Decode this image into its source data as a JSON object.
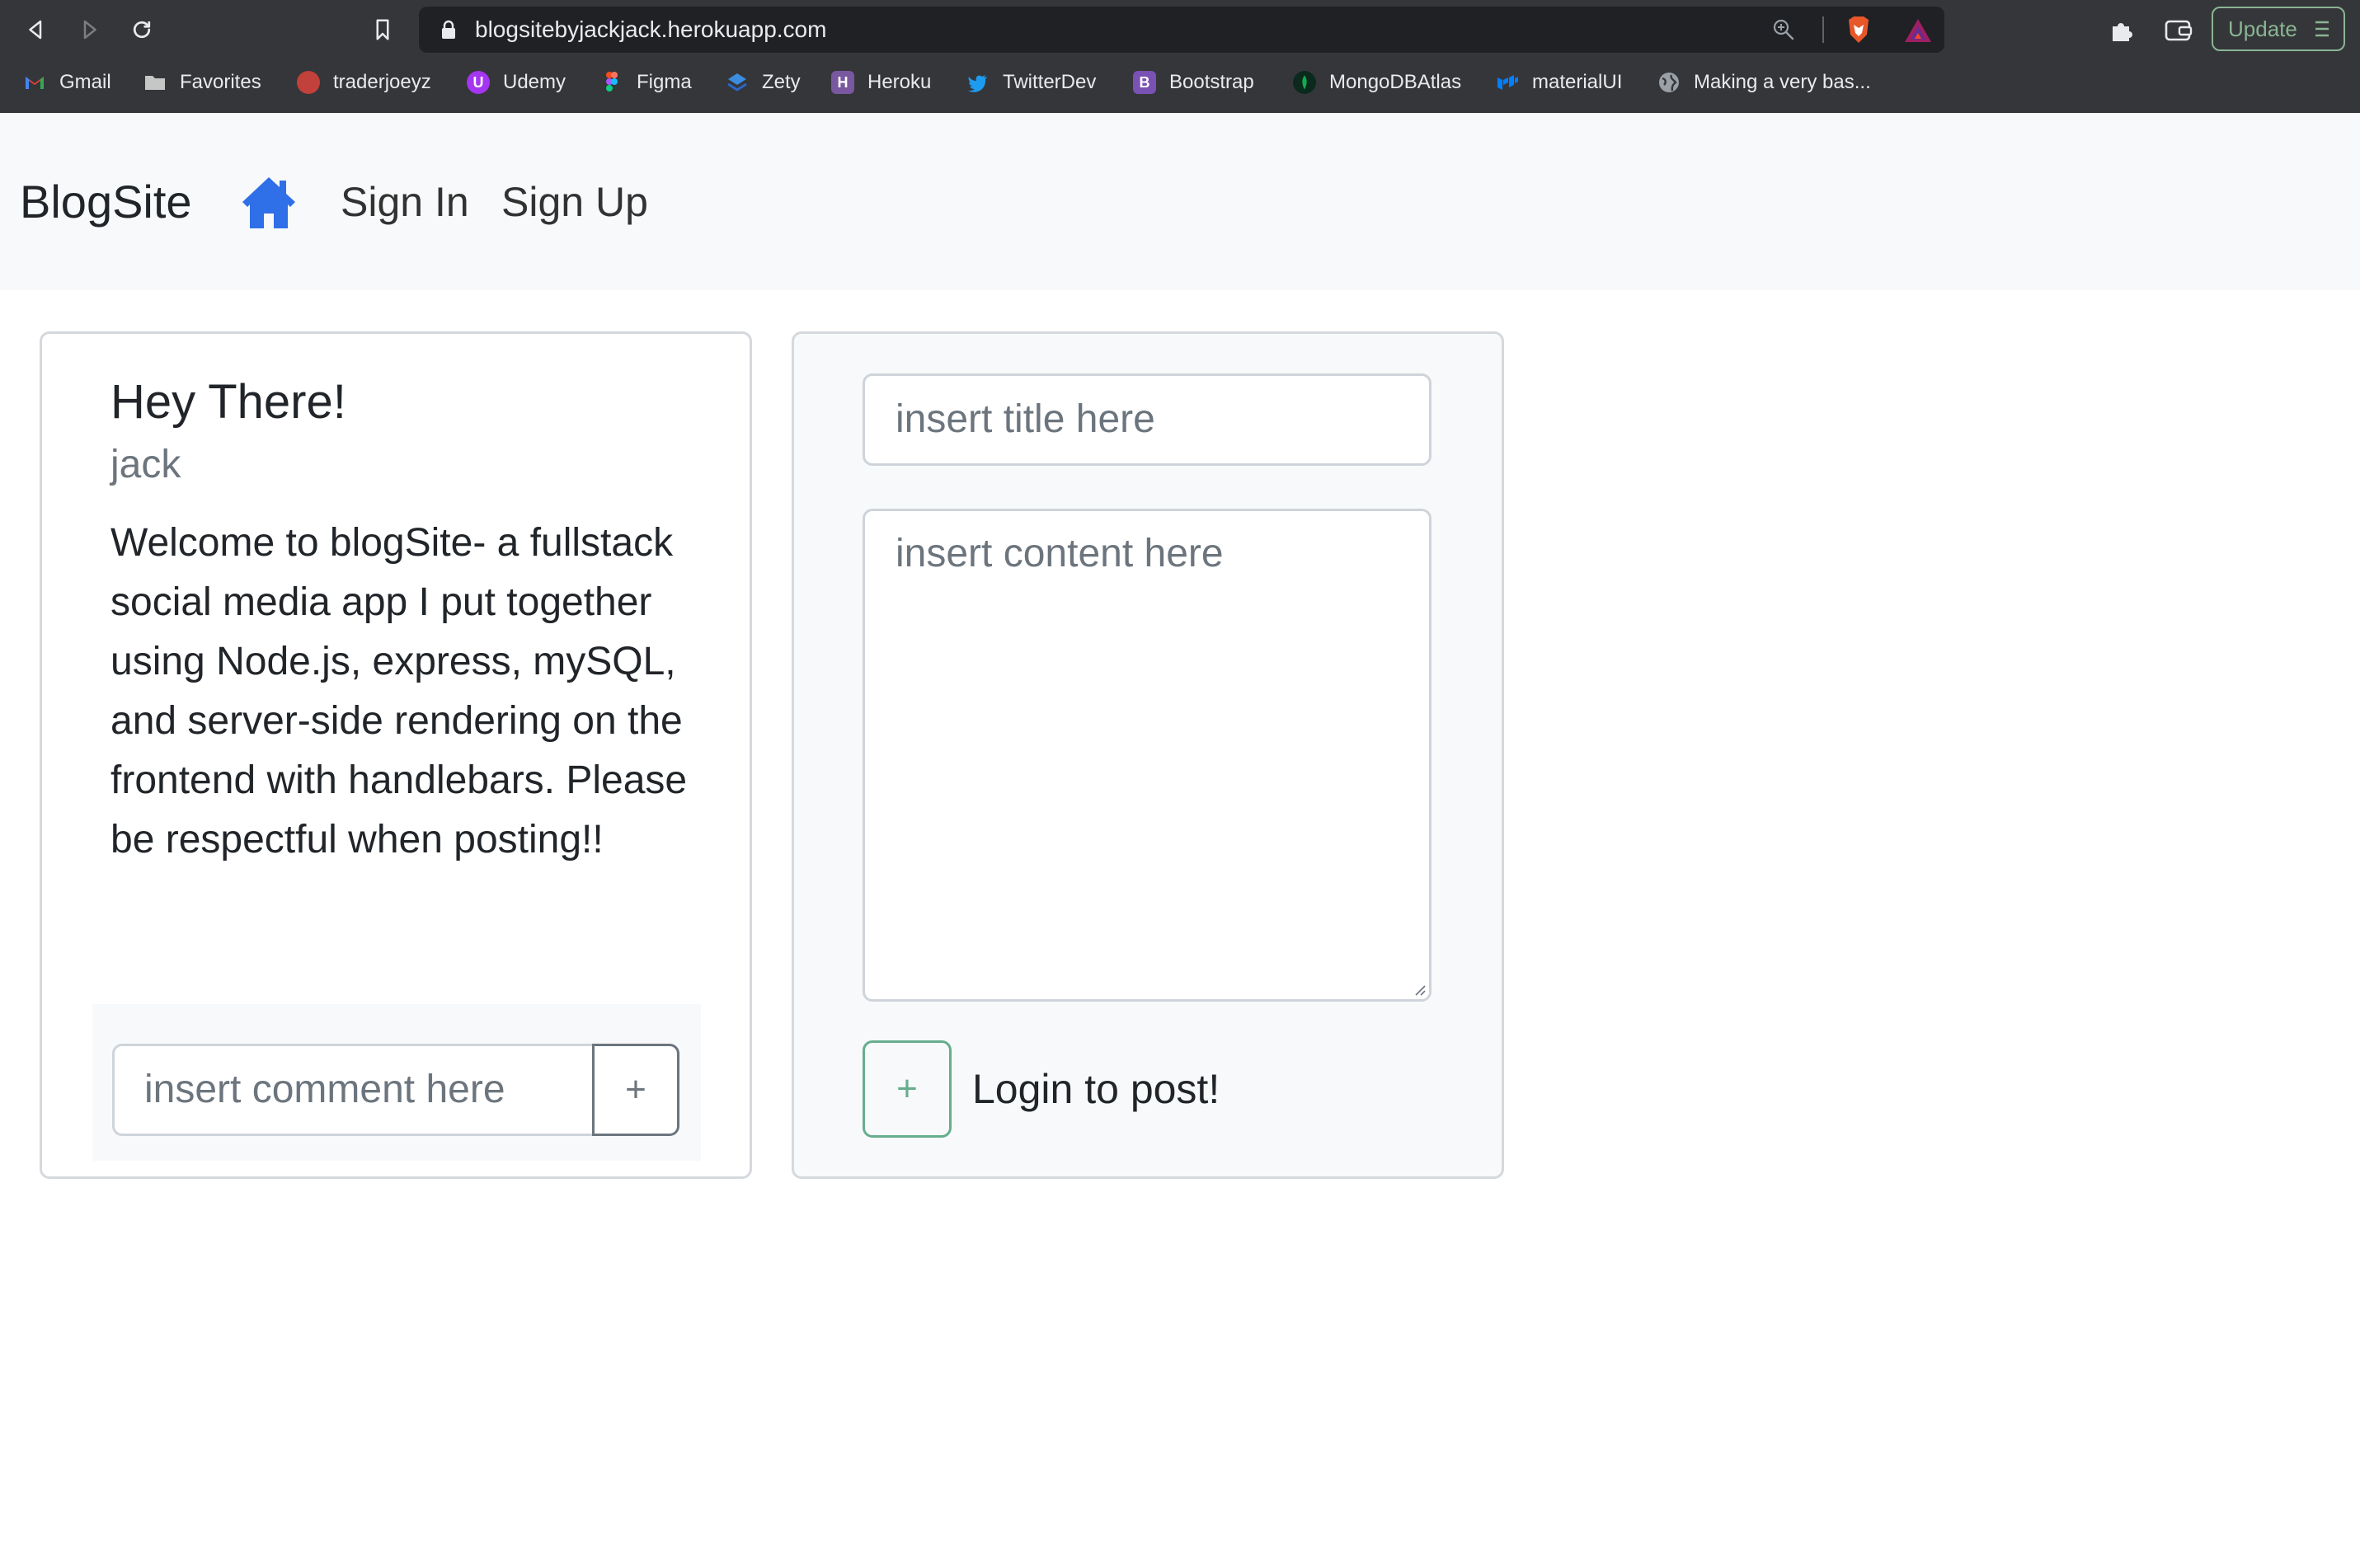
{
  "browser": {
    "url": "blogsitebyjackjack.herokuapp.com",
    "update_label": "Update",
    "bookmarks": [
      {
        "label": "Gmail",
        "icon": "gmail-icon"
      },
      {
        "label": "Favorites",
        "icon": "folder-icon"
      },
      {
        "label": "traderjoeyz",
        "icon": "traderjoeyz-icon"
      },
      {
        "label": "Udemy",
        "icon": "udemy-icon"
      },
      {
        "label": "Figma",
        "icon": "figma-icon"
      },
      {
        "label": "Zety",
        "icon": "zety-icon"
      },
      {
        "label": "Heroku",
        "icon": "heroku-icon"
      },
      {
        "label": "TwitterDev",
        "icon": "twitter-icon"
      },
      {
        "label": "Bootstrap",
        "icon": "bootstrap-icon"
      },
      {
        "label": "MongoDBAtlas",
        "icon": "mongodb-icon"
      },
      {
        "label": "materialUI",
        "icon": "materialui-icon"
      },
      {
        "label": "Making a very bas...",
        "icon": "globe-icon"
      }
    ]
  },
  "navbar": {
    "brand": "BlogSite",
    "home_icon": "home-icon",
    "links": [
      "Sign In",
      "Sign Up"
    ]
  },
  "post": {
    "title": "Hey There!",
    "author": "jack",
    "body": "Welcome to blogSite- a fullstack social media app I put together using Node.js, express, mySQL, and server-side rendering on the frontend with handlebars. Please be respectful when posting!!",
    "comment_placeholder": "insert comment here",
    "comment_button": "+"
  },
  "composer": {
    "title_placeholder": "insert title here",
    "content_placeholder": "insert content here",
    "post_button": "+",
    "post_label": "Login to post!"
  },
  "colors": {
    "accent": "#2f6fe8",
    "success": "#198754",
    "chrome": "#35363a"
  }
}
